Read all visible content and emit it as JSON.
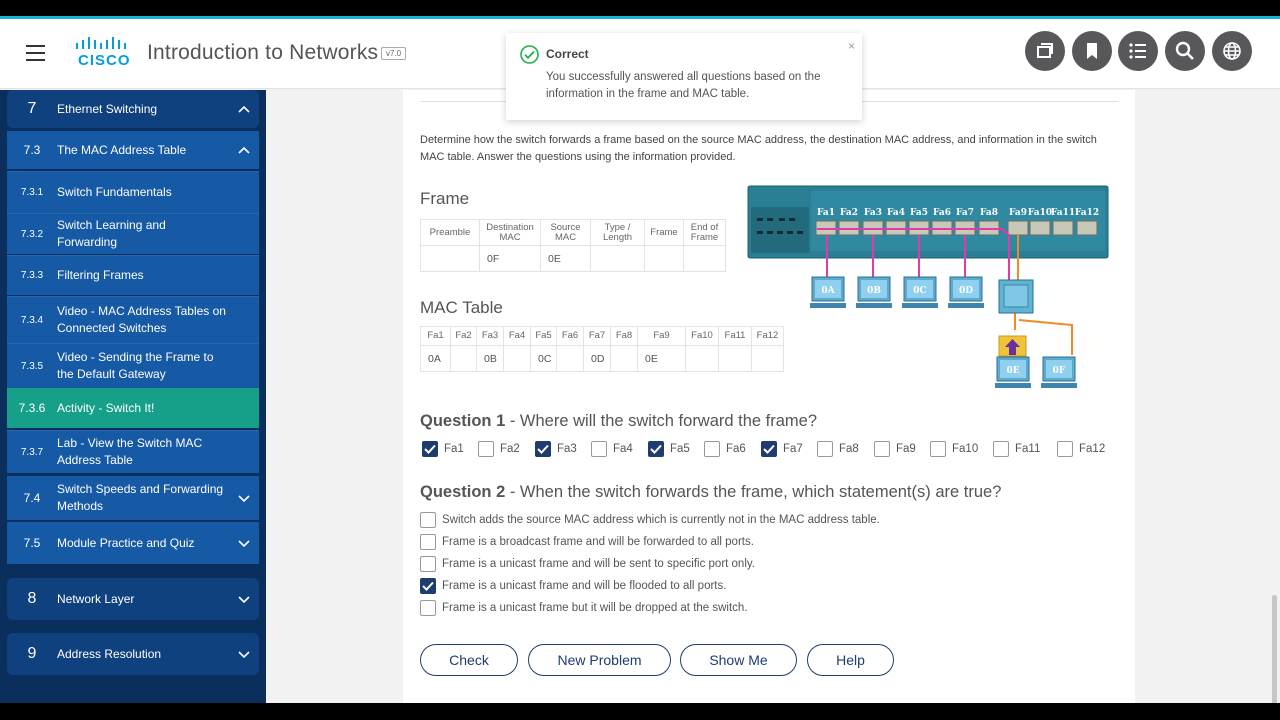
{
  "app": {
    "title": "Introduction to Networks",
    "version": "v7.0",
    "logo_text": "CISCO"
  },
  "header_icons": [
    "copy-icon",
    "bookmark-icon",
    "list-icon",
    "search-icon",
    "globe-icon"
  ],
  "sidebar": {
    "items": [
      {
        "num": "7",
        "label": "Ethernet Switching",
        "kind": "chapter",
        "chevron": "up"
      },
      {
        "num": "7.3",
        "label": "The MAC Address Table",
        "kind": "section",
        "chevron": "up"
      },
      {
        "num": "7.3.1",
        "label": "Switch Fundamentals",
        "kind": "sub"
      },
      {
        "num": "7.3.2",
        "label": "Switch Learning and Forwarding",
        "kind": "sub"
      },
      {
        "num": "7.3.3",
        "label": "Filtering Frames",
        "kind": "sub"
      },
      {
        "num": "7.3.4",
        "label": "Video - MAC Address Tables on Connected Switches",
        "kind": "sub"
      },
      {
        "num": "7.3.5",
        "label": "Video - Sending the Frame to the Default Gateway",
        "kind": "sub"
      },
      {
        "num": "7.3.6",
        "label": "Activity - Switch It!",
        "kind": "active"
      },
      {
        "num": "7.3.7",
        "label": "Lab - View the Switch MAC Address Table",
        "kind": "sub"
      },
      {
        "num": "7.4",
        "label": "Switch Speeds and Forwarding Methods",
        "kind": "section",
        "chevron": "down"
      },
      {
        "num": "7.5",
        "label": "Module Practice and Quiz",
        "kind": "section",
        "chevron": "down"
      },
      {
        "num": "8",
        "label": "Network Layer",
        "kind": "chapter",
        "chevron": "down"
      },
      {
        "num": "9",
        "label": "Address Resolution",
        "kind": "chapter",
        "chevron": "down"
      }
    ]
  },
  "toast": {
    "title": "Correct",
    "message": "You successfully answered all questions based on the information in the frame and MAC table.",
    "close": "×"
  },
  "instructions": "Determine how the switch forwards a frame based on the source MAC address, the destination MAC address, and information in the switch MAC table. Answer the questions using the information provided.",
  "frame": {
    "title": "Frame",
    "headers": [
      "Preamble",
      "Destination MAC",
      "Source MAC",
      "Type / Length",
      "Frame",
      "End of Frame"
    ],
    "values": [
      "",
      "0F",
      "0E",
      "",
      "",
      ""
    ]
  },
  "mac_table": {
    "title": "MAC Table",
    "headers": [
      "Fa1",
      "Fa2",
      "Fa3",
      "Fa4",
      "Fa5",
      "Fa6",
      "Fa7",
      "Fa8",
      "Fa9",
      "Fa10",
      "Fa11",
      "Fa12"
    ],
    "values": [
      "0A",
      "",
      "0B",
      "",
      "0C",
      "",
      "0D",
      "",
      "0E",
      "",
      "",
      ""
    ]
  },
  "diagram": {
    "port_labels": [
      "Fa1",
      "Fa2",
      "Fa3",
      "Fa4",
      "Fa5",
      "Fa6",
      "Fa7",
      "Fa8",
      "Fa9",
      "Fa10",
      "Fa11",
      "Fa12"
    ],
    "hosts": [
      "0A",
      "0B",
      "0C",
      "0D",
      "0E",
      "0F"
    ]
  },
  "question1": {
    "prefix": "Question 1",
    "text": " - Where will the switch forward the frame?",
    "options": [
      {
        "label": "Fa1",
        "checked": true
      },
      {
        "label": "Fa2",
        "checked": false
      },
      {
        "label": "Fa3",
        "checked": true
      },
      {
        "label": "Fa4",
        "checked": false
      },
      {
        "label": "Fa5",
        "checked": true
      },
      {
        "label": "Fa6",
        "checked": false
      },
      {
        "label": "Fa7",
        "checked": true
      },
      {
        "label": "Fa8",
        "checked": false
      },
      {
        "label": "Fa9",
        "checked": false
      },
      {
        "label": "Fa10",
        "checked": false
      },
      {
        "label": "Fa11",
        "checked": false
      },
      {
        "label": "Fa12",
        "checked": false
      }
    ]
  },
  "question2": {
    "prefix": "Question 2",
    "text": " - When the switch forwards the frame, which statement(s) are true?",
    "options": [
      {
        "label": "Switch adds the source MAC address which is currently not in the MAC address table.",
        "checked": false
      },
      {
        "label": "Frame is a broadcast frame and will be forwarded to all ports.",
        "checked": false
      },
      {
        "label": "Frame is a unicast frame and will be sent to specific port only.",
        "checked": false
      },
      {
        "label": "Frame is a unicast frame and will be flooded to all ports.",
        "checked": true
      },
      {
        "label": "Frame is a unicast frame but it will be dropped at the switch.",
        "checked": false
      }
    ]
  },
  "buttons": {
    "check": "Check",
    "new_problem": "New Problem",
    "show_me": "Show Me",
    "help": "Help"
  },
  "colors": {
    "accent": "#16b3d8",
    "sidebar": "#0b2f5c",
    "active": "#16a08a",
    "brand_blue": "#1e3c6e",
    "correct": "#22b04b"
  }
}
